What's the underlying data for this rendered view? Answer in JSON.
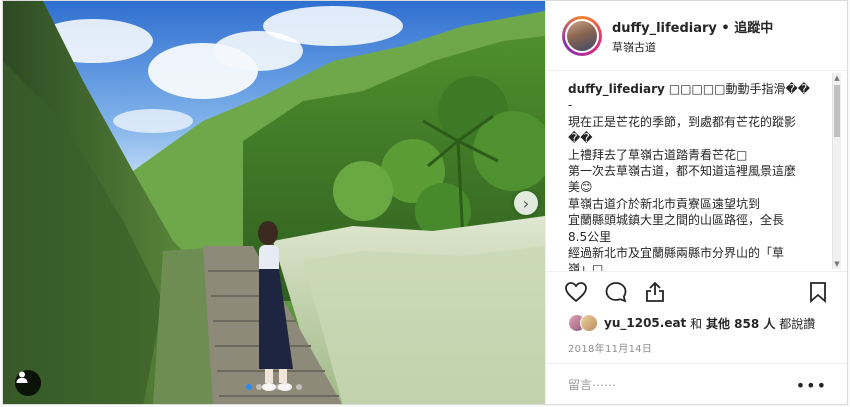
{
  "post": {
    "username": "duffy_lifediary",
    "separator": "•",
    "follow_label": "追蹤中",
    "location": "草嶺古道",
    "caption_lines": [
      "□□□□□動動手指滑��",
      "-",
      "現在正是芒花的季節，到處都有芒花的蹤影",
      "��",
      "上禮拜去了草嶺古道踏青看芒花□",
      "第一次去草嶺古道，都不知道這裡風景這麼",
      "美😊",
      "草嶺古道介於新北市貢寮區遠望坑到",
      "宜蘭縣頭城鎮大里之間的山區路徑，全長",
      "8.5公里",
      "經過新北市及宜蘭縣兩縣市分界山的「草",
      "嶺」□"
    ],
    "likes_user": "yu_1205.eat",
    "likes_text_and": "和",
    "likes_others": "其他 858 人",
    "likes_suffix": "都說讚",
    "date": "2018年11月14日",
    "comment_placeholder": "留言⋯⋯",
    "more_label": "•••",
    "carousel": {
      "count": 6,
      "active": 0
    }
  },
  "icons": {
    "heart": "heart-icon",
    "comment": "comment-icon",
    "share": "share-icon",
    "bookmark": "bookmark-icon",
    "next": "chevron-right-icon",
    "user_tag": "user-tag-icon"
  },
  "colors": {
    "carousel_active": "#2b8af0",
    "text": "#262626",
    "muted": "#8e8e8e"
  }
}
